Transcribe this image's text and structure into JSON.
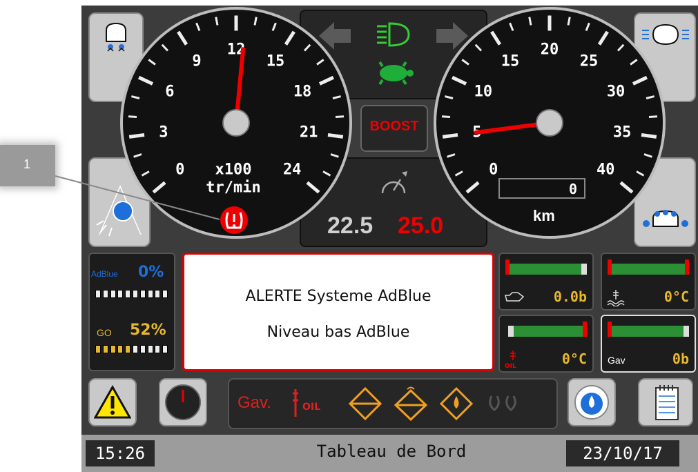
{
  "callout": {
    "number": "1"
  },
  "rpm_gauge": {
    "ticks": [
      "0",
      "3",
      "6",
      "9",
      "12",
      "15",
      "18",
      "21",
      "24"
    ],
    "unit_line1": "x100",
    "unit_line2": "tr/min",
    "needle_value": 12.5
  },
  "speed_gauge": {
    "ticks": [
      "0",
      "5",
      "10",
      "15",
      "20",
      "25",
      "30",
      "35",
      "40"
    ],
    "odometer": "0",
    "unit": "km",
    "needle_value": 5
  },
  "center": {
    "boost_label": "BOOST",
    "target_speed": "22.5",
    "set_speed": "25.0"
  },
  "message": {
    "line1": "ALERTE Systeme AdBlue",
    "line2": "Niveau bas AdBlue"
  },
  "fluids": {
    "adblue_label": "AdBlue",
    "adblue_percent": "0%",
    "go_label": "GO",
    "go_percent": "52%",
    "adblue_level": 0,
    "go_level": 0.52
  },
  "mini_gauges": {
    "oil_pressure": "0.0b",
    "coolant_temp": "0°C",
    "oil_temp": "0°C",
    "gav_label": "Gav",
    "gav_pressure": "0b"
  },
  "warning_strip": {
    "gav_label": "Gav.",
    "oil_label": "OIL"
  },
  "status": {
    "time": "15:26",
    "title": "Tableau de Bord",
    "date": "23/10/17"
  },
  "colors": {
    "alert_red": "#e00000",
    "ok_green": "#2a8f35",
    "value_yellow": "#e6b82e",
    "adblue_blue": "#1e6fd9",
    "indicator_green": "#33cc33",
    "warning_orange": "#f0a020"
  },
  "icons": [
    "work-lights-rear-icon",
    "work-lights-side-icon",
    "beacon-icon",
    "front-lights-icon",
    "arrow-left-icon",
    "arrow-right-icon",
    "headlight-icon",
    "turtle-icon",
    "tire-pressure-icon",
    "cruise-control-icon",
    "warning-triangle-icon",
    "tachograph-icon",
    "hydraulic-oil-icon",
    "filter-icon",
    "water-separator-icon",
    "clipboard-icon"
  ]
}
